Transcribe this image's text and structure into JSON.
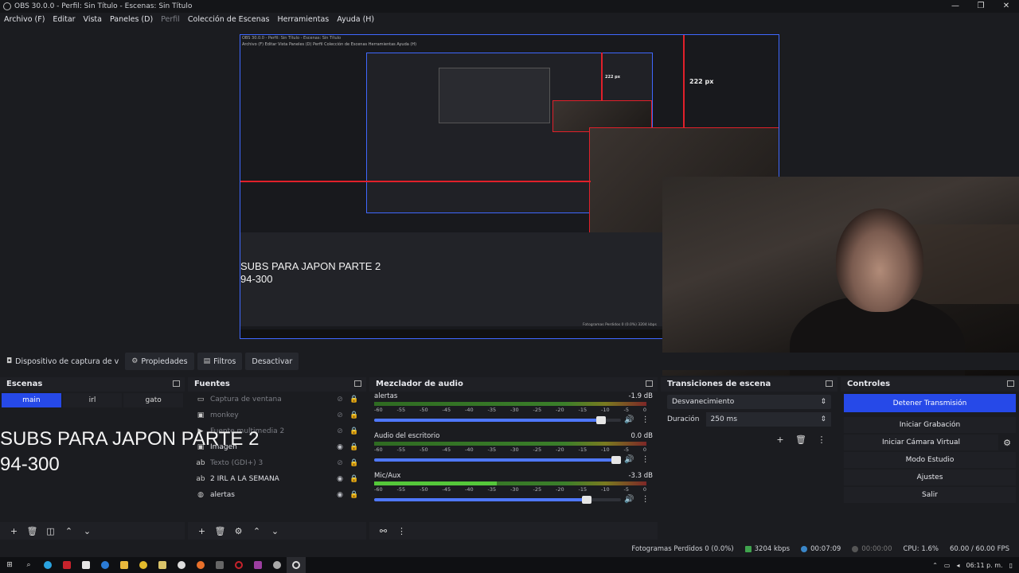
{
  "window": {
    "title": "OBS 30.0.0 - Perfil: Sin Título - Escenas: Sin Título",
    "controls": [
      "—",
      "❐",
      "✕"
    ]
  },
  "menu": [
    "Archivo (F)",
    "Editar",
    "Vista",
    "Paneles (D)",
    "Perfil",
    "Colección de Escenas",
    "Herramientas",
    "Ayuda (H)"
  ],
  "preview": {
    "nested_title": "OBS 30.0.0 - Perfil: Sin Título - Escenas: Sin Título",
    "nested_menu": "Archivo (F)   Editar   Vista   Paneles (D)   Perfil   Colección de Escenas   Herramientas   Ayuda (H)",
    "measure_label_1": "222 px",
    "measure_label_2": "222 px",
    "nested_sub_line1": "SUBS PARA JAPON PARTE 2",
    "nested_sub_line2": "94-300",
    "nested_status": "Fotogramas Perdidos 0 (0.0%)   3204 kbps"
  },
  "source_toolbar": {
    "device": "Dispositivo de captura de v",
    "properties": "Propiedades",
    "filters": "Filtros",
    "deactivate": "Desactivar"
  },
  "scenes": {
    "title": "Escenas",
    "items": [
      {
        "label": "main",
        "active": true
      },
      {
        "label": "irl",
        "active": false
      },
      {
        "label": "gato",
        "active": false
      }
    ],
    "overlay_line1": "SUBS PARA JAPON PARTE 2",
    "overlay_line2": "94-300"
  },
  "sources": {
    "title": "Fuentes",
    "items": [
      {
        "name": "Captura de ventana",
        "icon": "window-icon",
        "glyph": "▭",
        "visible": false
      },
      {
        "name": "monkey",
        "icon": "image-icon",
        "glyph": "▣",
        "visible": false
      },
      {
        "name": "Fuente multimedia 2",
        "icon": "media-icon",
        "glyph": "▶",
        "visible": false
      },
      {
        "name": "Imagen",
        "icon": "image-icon",
        "glyph": "▣",
        "visible": true
      },
      {
        "name": "Texto (GDI+) 3",
        "icon": "text-icon",
        "glyph": "ab",
        "visible": false
      },
      {
        "name": "2 IRL A LA SEMANA",
        "icon": "text-icon",
        "glyph": "ab",
        "visible": true
      },
      {
        "name": "alertas",
        "icon": "browser-icon",
        "glyph": "◍",
        "visible": true
      }
    ]
  },
  "mixer": {
    "title": "Mezclador de audio",
    "scale": [
      "-60",
      "-55",
      "-50",
      "-45",
      "-40",
      "-35",
      "-30",
      "-25",
      "-20",
      "-15",
      "-10",
      "-5",
      "0"
    ],
    "channels": [
      {
        "name": "alertas",
        "db": "-1.9 dB",
        "level": 0,
        "fader": 0.94
      },
      {
        "name": "Audio del escritorio",
        "db": "0.0 dB",
        "level": 0,
        "fader": 1.0
      },
      {
        "name": "Mic/Aux",
        "db": "-3.3 dB",
        "level": 0.45,
        "fader": 0.88
      }
    ]
  },
  "transitions": {
    "title": "Transiciones de escena",
    "selected": "Desvanecimiento",
    "duration_label": "Duración",
    "duration_value": "250 ms"
  },
  "controls": {
    "title": "Controles",
    "stop_stream": "Detener Transmisión",
    "start_recording": "Iniciar Grabación",
    "start_virtual_cam": "Iniciar Cámara Virtual",
    "studio_mode": "Modo Estudio",
    "settings": "Ajustes",
    "exit": "Salir"
  },
  "status": {
    "dropped_frames": "Fotogramas Perdidos 0 (0.0%)",
    "bitrate": "3204 kbps",
    "stream_time": "00:07:09",
    "rec_time": "00:00:00",
    "cpu": "CPU: 1.6%",
    "fps": "60.00 / 60.00 FPS"
  },
  "taskbar": {
    "clock": "06:11 p. m."
  },
  "colors": {
    "accent": "#2649e8",
    "measure_red": "#e0202a",
    "selection_blue": "#3f68ff"
  }
}
